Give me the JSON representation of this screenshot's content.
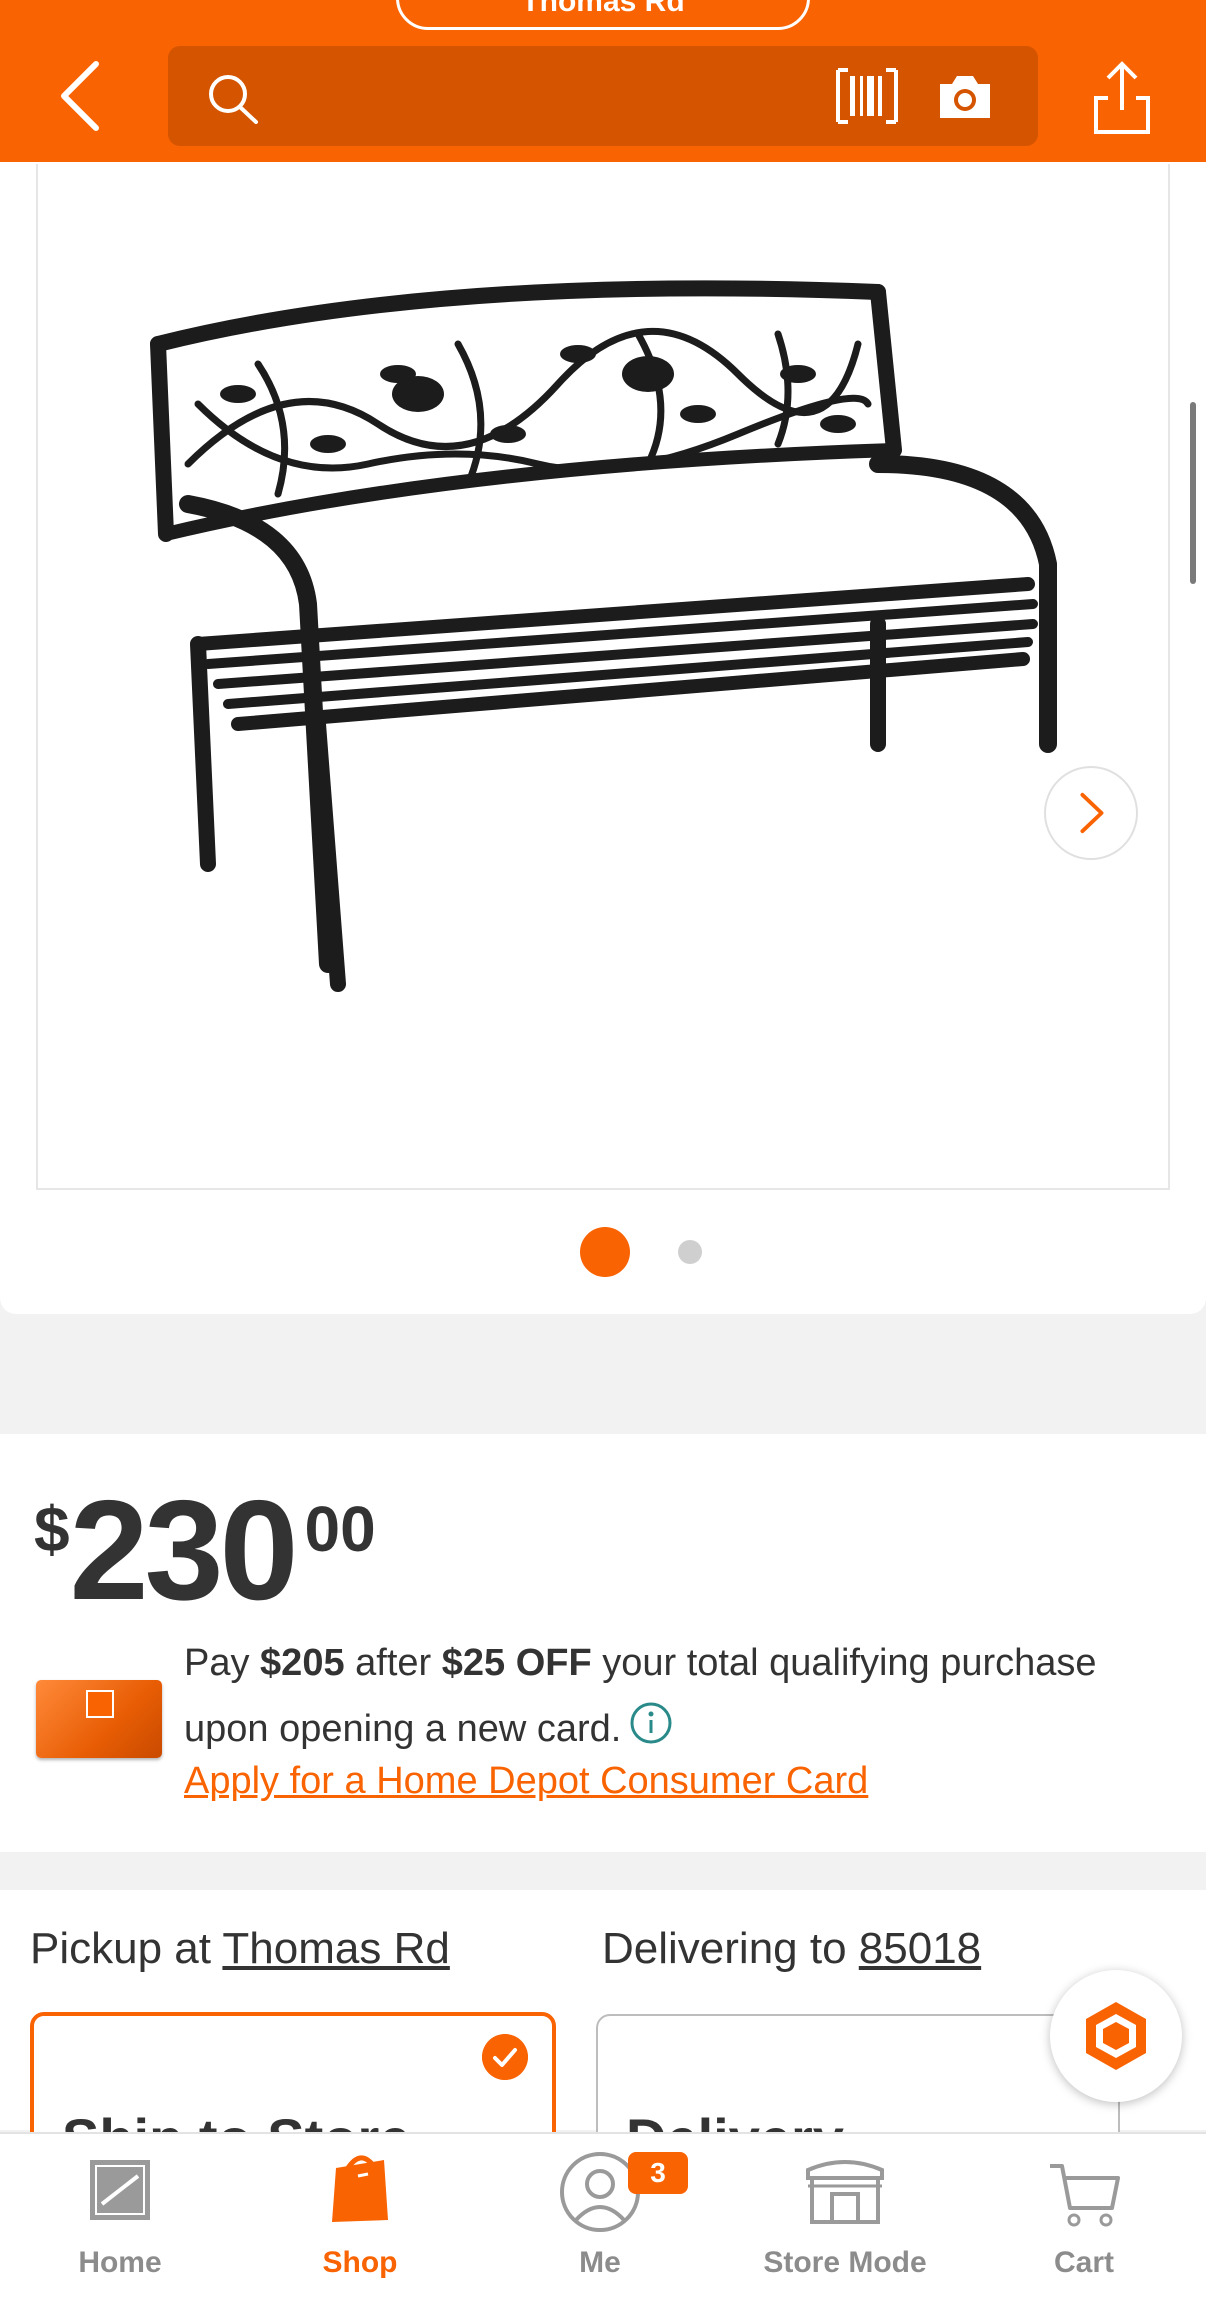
{
  "header": {
    "store_label": "Thomas Rd",
    "search_placeholder": "",
    "icons": [
      "back-icon",
      "search-icon",
      "barcode-icon",
      "camera-icon",
      "share-icon"
    ]
  },
  "gallery": {
    "current_index": 1,
    "total_images": 2
  },
  "price": {
    "currency": "$",
    "dollars": "230",
    "cents": "00"
  },
  "card_offer": {
    "pay": "Pay ",
    "pay_amount": "$205",
    "after": " after ",
    "off_amount": "$25 OFF",
    "rest": " your total qualifying purchase upon opening a new card.",
    "apply_link": "Apply for a Home Depot Consumer Card"
  },
  "fulfillment": {
    "pickup_prefix": "Pickup at ",
    "pickup_store": "Thomas Rd",
    "deliver_prefix": "Delivering to ",
    "deliver_zip": "85018",
    "options": [
      {
        "title": "Ship to Store",
        "selected": true
      },
      {
        "title": "Delivery",
        "selected": false
      }
    ]
  },
  "bottom_nav": {
    "items": [
      {
        "label": "Home",
        "icon": "home-depot-logo-icon",
        "active": false
      },
      {
        "label": "Shop",
        "icon": "shop-bag-icon",
        "active": true
      },
      {
        "label": "Me",
        "icon": "profile-icon",
        "active": false,
        "badge": "3"
      },
      {
        "label": "Store Mode",
        "icon": "store-icon",
        "active": false
      },
      {
        "label": "Cart",
        "icon": "cart-icon",
        "active": false
      }
    ]
  },
  "colors": {
    "brand_orange": "#f96302",
    "search_bg": "#d45400",
    "text": "#333333",
    "muted": "#8c8c8c"
  }
}
